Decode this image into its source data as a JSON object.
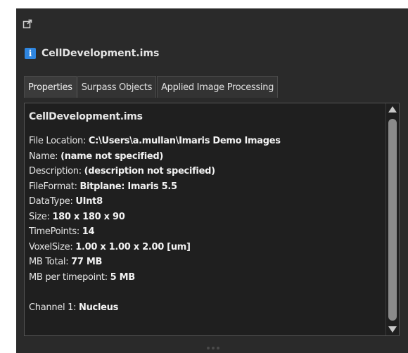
{
  "panel": {
    "title": "CellDevelopment.ims",
    "undock_icon": "undock-icon",
    "info_icon": "info-icon",
    "info_icon_glyph": "i"
  },
  "tabs": [
    {
      "label": "Properties",
      "active": true
    },
    {
      "label": "Surpass Objects",
      "active": false
    },
    {
      "label": "Applied Image Processing",
      "active": false
    }
  ],
  "properties": {
    "heading": "CellDevelopment.ims",
    "rows": [
      {
        "label": "File Location: ",
        "value": "C:\\Users\\a.mullan\\Imaris Demo Images"
      },
      {
        "label": "Name: ",
        "value": "(name not specified)"
      },
      {
        "label": "Description: ",
        "value": "(description not specified)"
      },
      {
        "label": "FileFormat: ",
        "value": "Bitplane: Imaris 5.5"
      },
      {
        "label": "DataType: ",
        "value": "UInt8"
      },
      {
        "label": "Size: ",
        "value": "180 x 180 x 90"
      },
      {
        "label": "TimePoints: ",
        "value": "14"
      },
      {
        "label": "VoxelSize: ",
        "value": "1.00 x 1.00 x 2.00 [um]"
      },
      {
        "label": "MB Total: ",
        "value": "77 MB"
      },
      {
        "label": "MB per timepoint: ",
        "value": "5 MB"
      }
    ],
    "channel": {
      "label": "Channel 1: ",
      "value": "Nucleus"
    }
  },
  "colors": {
    "panel_bg": "#2a2a2a",
    "content_bg": "#1f1f1f",
    "accent": "#2f86e0",
    "text": "#e6e6e6"
  }
}
